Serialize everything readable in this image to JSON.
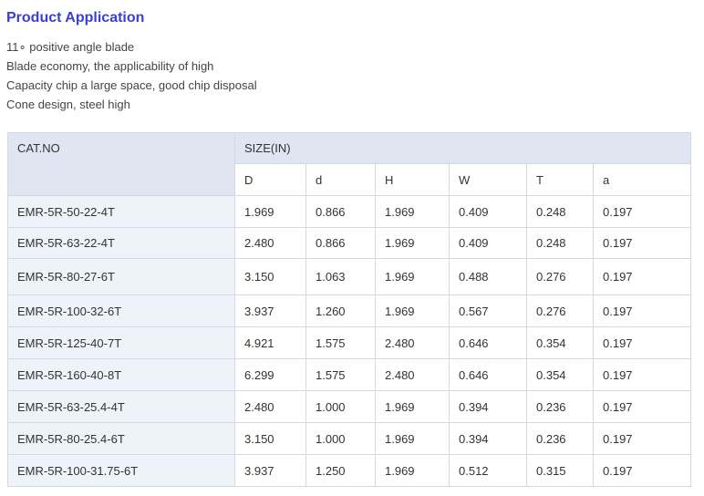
{
  "title": "Product Application",
  "features": [
    "11∘ positive angle blade",
    "Blade economy, the applicability of high",
    "Capacity chip a large space, good chip disposal",
    "Cone design, steel high"
  ],
  "table": {
    "cat_header": "CAT.NO",
    "size_header": "SIZE(IN)",
    "columns": [
      "D",
      "d",
      "H",
      "W",
      "T",
      "a"
    ],
    "rows": [
      {
        "cat": "EMR-5R-50-22-4T",
        "values": [
          "1.969",
          "0.866",
          "1.969",
          "0.409",
          "0.248",
          "0.197"
        ]
      },
      {
        "cat": "EMR-5R-63-22-4T",
        "values": [
          "2.480",
          "0.866",
          "1.969",
          "0.409",
          "0.248",
          "0.197"
        ]
      },
      {
        "cat": "EMR-5R-80-27-6T",
        "values": [
          "3.150",
          "1.063",
          "1.969",
          "0.488",
          "0.276",
          "0.197"
        ]
      },
      {
        "cat": "EMR-5R-100-32-6T",
        "values": [
          "3.937",
          "1.260",
          "1.969",
          "0.567",
          "0.276",
          "0.197"
        ]
      },
      {
        "cat": "EMR-5R-125-40-7T",
        "values": [
          "4.921",
          "1.575",
          "2.480",
          "0.646",
          "0.354",
          "0.197"
        ]
      },
      {
        "cat": "EMR-5R-160-40-8T",
        "values": [
          "6.299",
          "1.575",
          "2.480",
          "0.646",
          "0.354",
          "0.197"
        ]
      },
      {
        "cat": "EMR-5R-63-25.4-4T",
        "values": [
          "2.480",
          "1.000",
          "1.969",
          "0.394",
          "0.236",
          "0.197"
        ]
      },
      {
        "cat": "EMR-5R-80-25.4-6T",
        "values": [
          "3.150",
          "1.000",
          "1.969",
          "0.394",
          "0.236",
          "0.197"
        ]
      },
      {
        "cat": "EMR-5R-100-31.75-6T",
        "values": [
          "3.937",
          "1.250",
          "1.969",
          "0.512",
          "0.315",
          "0.197"
        ]
      }
    ]
  }
}
